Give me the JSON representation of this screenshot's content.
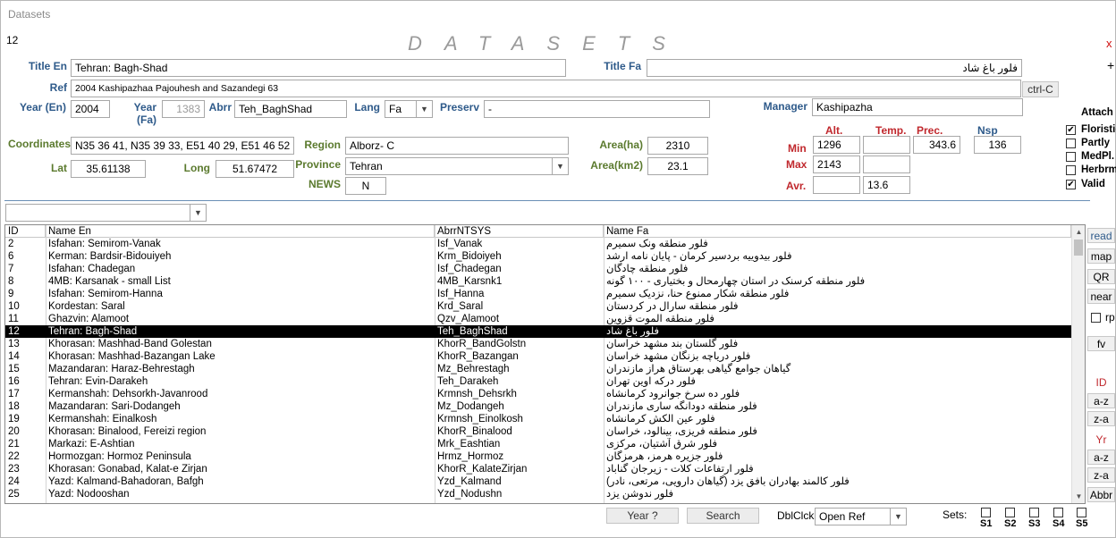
{
  "window": {
    "title": "Datasets",
    "record_id": "12",
    "banner": "DATASETS",
    "close_label": "x",
    "add_label": "+"
  },
  "form": {
    "title_en_label": "Title En",
    "title_en": "Tehran: Bagh-Shad",
    "title_fa_label": "Title Fa",
    "title_fa": "فلور باغ شاد",
    "ref_label": "Ref",
    "ref": "2004 Kashipazhaa Pajouhesh and Sazandegi 63",
    "ctrl_c_label": "ctrl-C",
    "year_en_label": "Year (En)",
    "year_en": "2004",
    "year_fa_label": "Year (Fa)",
    "year_fa": "1383",
    "abrr_label": "Abrr",
    "abrr": "Teh_BaghShad",
    "lang_label": "Lang",
    "lang": "Fa",
    "preserv_label": "Preserv",
    "preserv": "-",
    "manager_label": "Manager",
    "manager": "Kashipazha",
    "coordinates_label": "Coordinates",
    "coordinates": "N35 36 41, N35 39 33, E51 40 29, E51 46 52",
    "region_label": "Region",
    "region": "Alborz- C",
    "area_ha_label": "Area(ha)",
    "area_ha": "2310",
    "lat_label": "Lat",
    "lat": "35.61138",
    "long_label": "Long",
    "long": "51.67472",
    "province_label": "Province",
    "province": "Tehran",
    "area_km2_label": "Area(km2)",
    "area_km2": "23.1",
    "news_label": "NEWS",
    "news": "N"
  },
  "stats": {
    "alt_label": "Alt.",
    "temp_label": "Temp.",
    "prec_label": "Prec.",
    "nsp_label": "Nsp",
    "min_label": "Min",
    "max_label": "Max",
    "avr_label": "Avr.",
    "min_alt": "1296",
    "min_temp": "",
    "min_prec": "343.6",
    "nsp": "136",
    "max_alt": "2143",
    "max_temp": "",
    "avr_alt": "",
    "avr_temp": "13.6"
  },
  "attach": {
    "label": "Attach",
    "items": [
      {
        "label": "Floristic",
        "checked": "✔"
      },
      {
        "label": "Partly",
        "checked": ""
      },
      {
        "label": "MedPl.",
        "checked": ""
      },
      {
        "label": "Herbrm",
        "checked": ""
      },
      {
        "label": "Valid",
        "checked": "✔"
      }
    ]
  },
  "filter": {
    "value": ""
  },
  "table": {
    "columns": [
      "ID",
      "Name En",
      "AbrrNTSYS",
      "Name Fa"
    ],
    "rows": [
      [
        "2",
        "Isfahan: Semirom-Vanak",
        "Isf_Vanak",
        "فلور منطقه ونک سمیرم"
      ],
      [
        "6",
        "Kerman: Bardsir-Bidouiyeh",
        "Krm_Bidoiyeh",
        "فلور بیدوییه بردسیر کرمان - پایان نامه ارشد"
      ],
      [
        "7",
        "Isfahan: Chadegan",
        "Isf_Chadegan",
        "فلور منطقه چادگان"
      ],
      [
        "8",
        "4MB: Karsanak - small List",
        "4MB_Karsnk1",
        "فلور منطقه کرسنک در استان چهارمحال و بختیاری - ۱۰۰ گونه"
      ],
      [
        "9",
        "Isfahan: Semirom-Hanna",
        "Isf_Hanna",
        "فلور منطقه شکار ممنوع حنا، نزدیک سمیرم"
      ],
      [
        "10",
        "Kordestan: Saral",
        "Krd_Saral",
        "فلور منطقه سارال در کردستان"
      ],
      [
        "11",
        "Ghazvin: Alamoot",
        "Qzv_Alamoot",
        "فلور منطقه الموت قزوین"
      ],
      [
        "12",
        "Tehran: Bagh-Shad",
        "Teh_BaghShad",
        "فلور باغ شاد"
      ],
      [
        "13",
        "Khorasan: Mashhad-Band Golestan",
        "KhorR_BandGolstn",
        "فلور گلستان بند مشهد خراسان"
      ],
      [
        "14",
        "Khorasan: Mashhad-Bazangan Lake",
        "KhorR_Bazangan",
        "فلور دریاچه بزنگان مشهد خراسان"
      ],
      [
        "15",
        "Mazandaran: Haraz-Behrestagh",
        "Mz_Behrestagh",
        "گیاهان جوامع گیاهی بهرستاق هراز مازندران"
      ],
      [
        "16",
        "Tehran: Evin-Darakeh",
        "Teh_Darakeh",
        "فلور درکه اوین تهران"
      ],
      [
        "17",
        "Kermanshah: Dehsorkh-Javanrood",
        "Krmnsh_Dehsrkh",
        "فلور ده سرخ جوانرود کرمانشاه"
      ],
      [
        "18",
        "Mazandaran: Sari-Dodangeh",
        "Mz_Dodangeh",
        "فلور منطقه دودانگه ساری مازندران"
      ],
      [
        "19",
        "Kermanshah: Einalkosh",
        "Krmnsh_Einolkosh",
        "فلور عین الکش کرمانشاه"
      ],
      [
        "20",
        "Khorasan: Binalood, Fereizi region",
        "KhorR_Binalood",
        "فلور منطقه فریزی، بینالود، خراسان"
      ],
      [
        "21",
        "Markazi: E-Ashtian",
        "Mrk_Eashtian",
        "فلور شرق آشتیان، مرکزی"
      ],
      [
        "22",
        "Hormozgan: Hormoz Peninsula",
        "Hrmz_Hormoz",
        "فلور جزیره هرمز، هرمزگان"
      ],
      [
        "23",
        "Khorasan: Gonabad, Kalat-e Zirjan",
        "KhorR_KalateZirjan",
        "فلور ارتفاعات کلات - زیرجان گناباد"
      ],
      [
        "24",
        "Yazd: Kalmand-Bahadoran, Bafgh",
        "Yzd_Kalmand",
        "فلور کالمند بهادران بافق یزد (گیاهان دارویی، مرتعی، نادر)"
      ],
      [
        "25",
        "Yazd: Nodooshan",
        "Yzd_Nodushn",
        "فلور ندوشن یزد"
      ]
    ],
    "selected_row": 7
  },
  "side_buttons": {
    "read": "read",
    "map": "map",
    "qr": "QR",
    "near": "near",
    "rp": "rp",
    "fv": "fv",
    "id": "ID",
    "az1": "a-z",
    "za1": "z-a",
    "yr": "Yr",
    "az2": "a-z",
    "za2": "z-a",
    "abbr": "Abbr"
  },
  "footer": {
    "year_btn": "Year ?",
    "search_btn": "Search",
    "dblclk_label": "DblClck:",
    "dblclk_value": "Open Ref",
    "sets_label": "Sets:",
    "sets": [
      "S1",
      "S2",
      "S3",
      "S4",
      "S5"
    ]
  }
}
